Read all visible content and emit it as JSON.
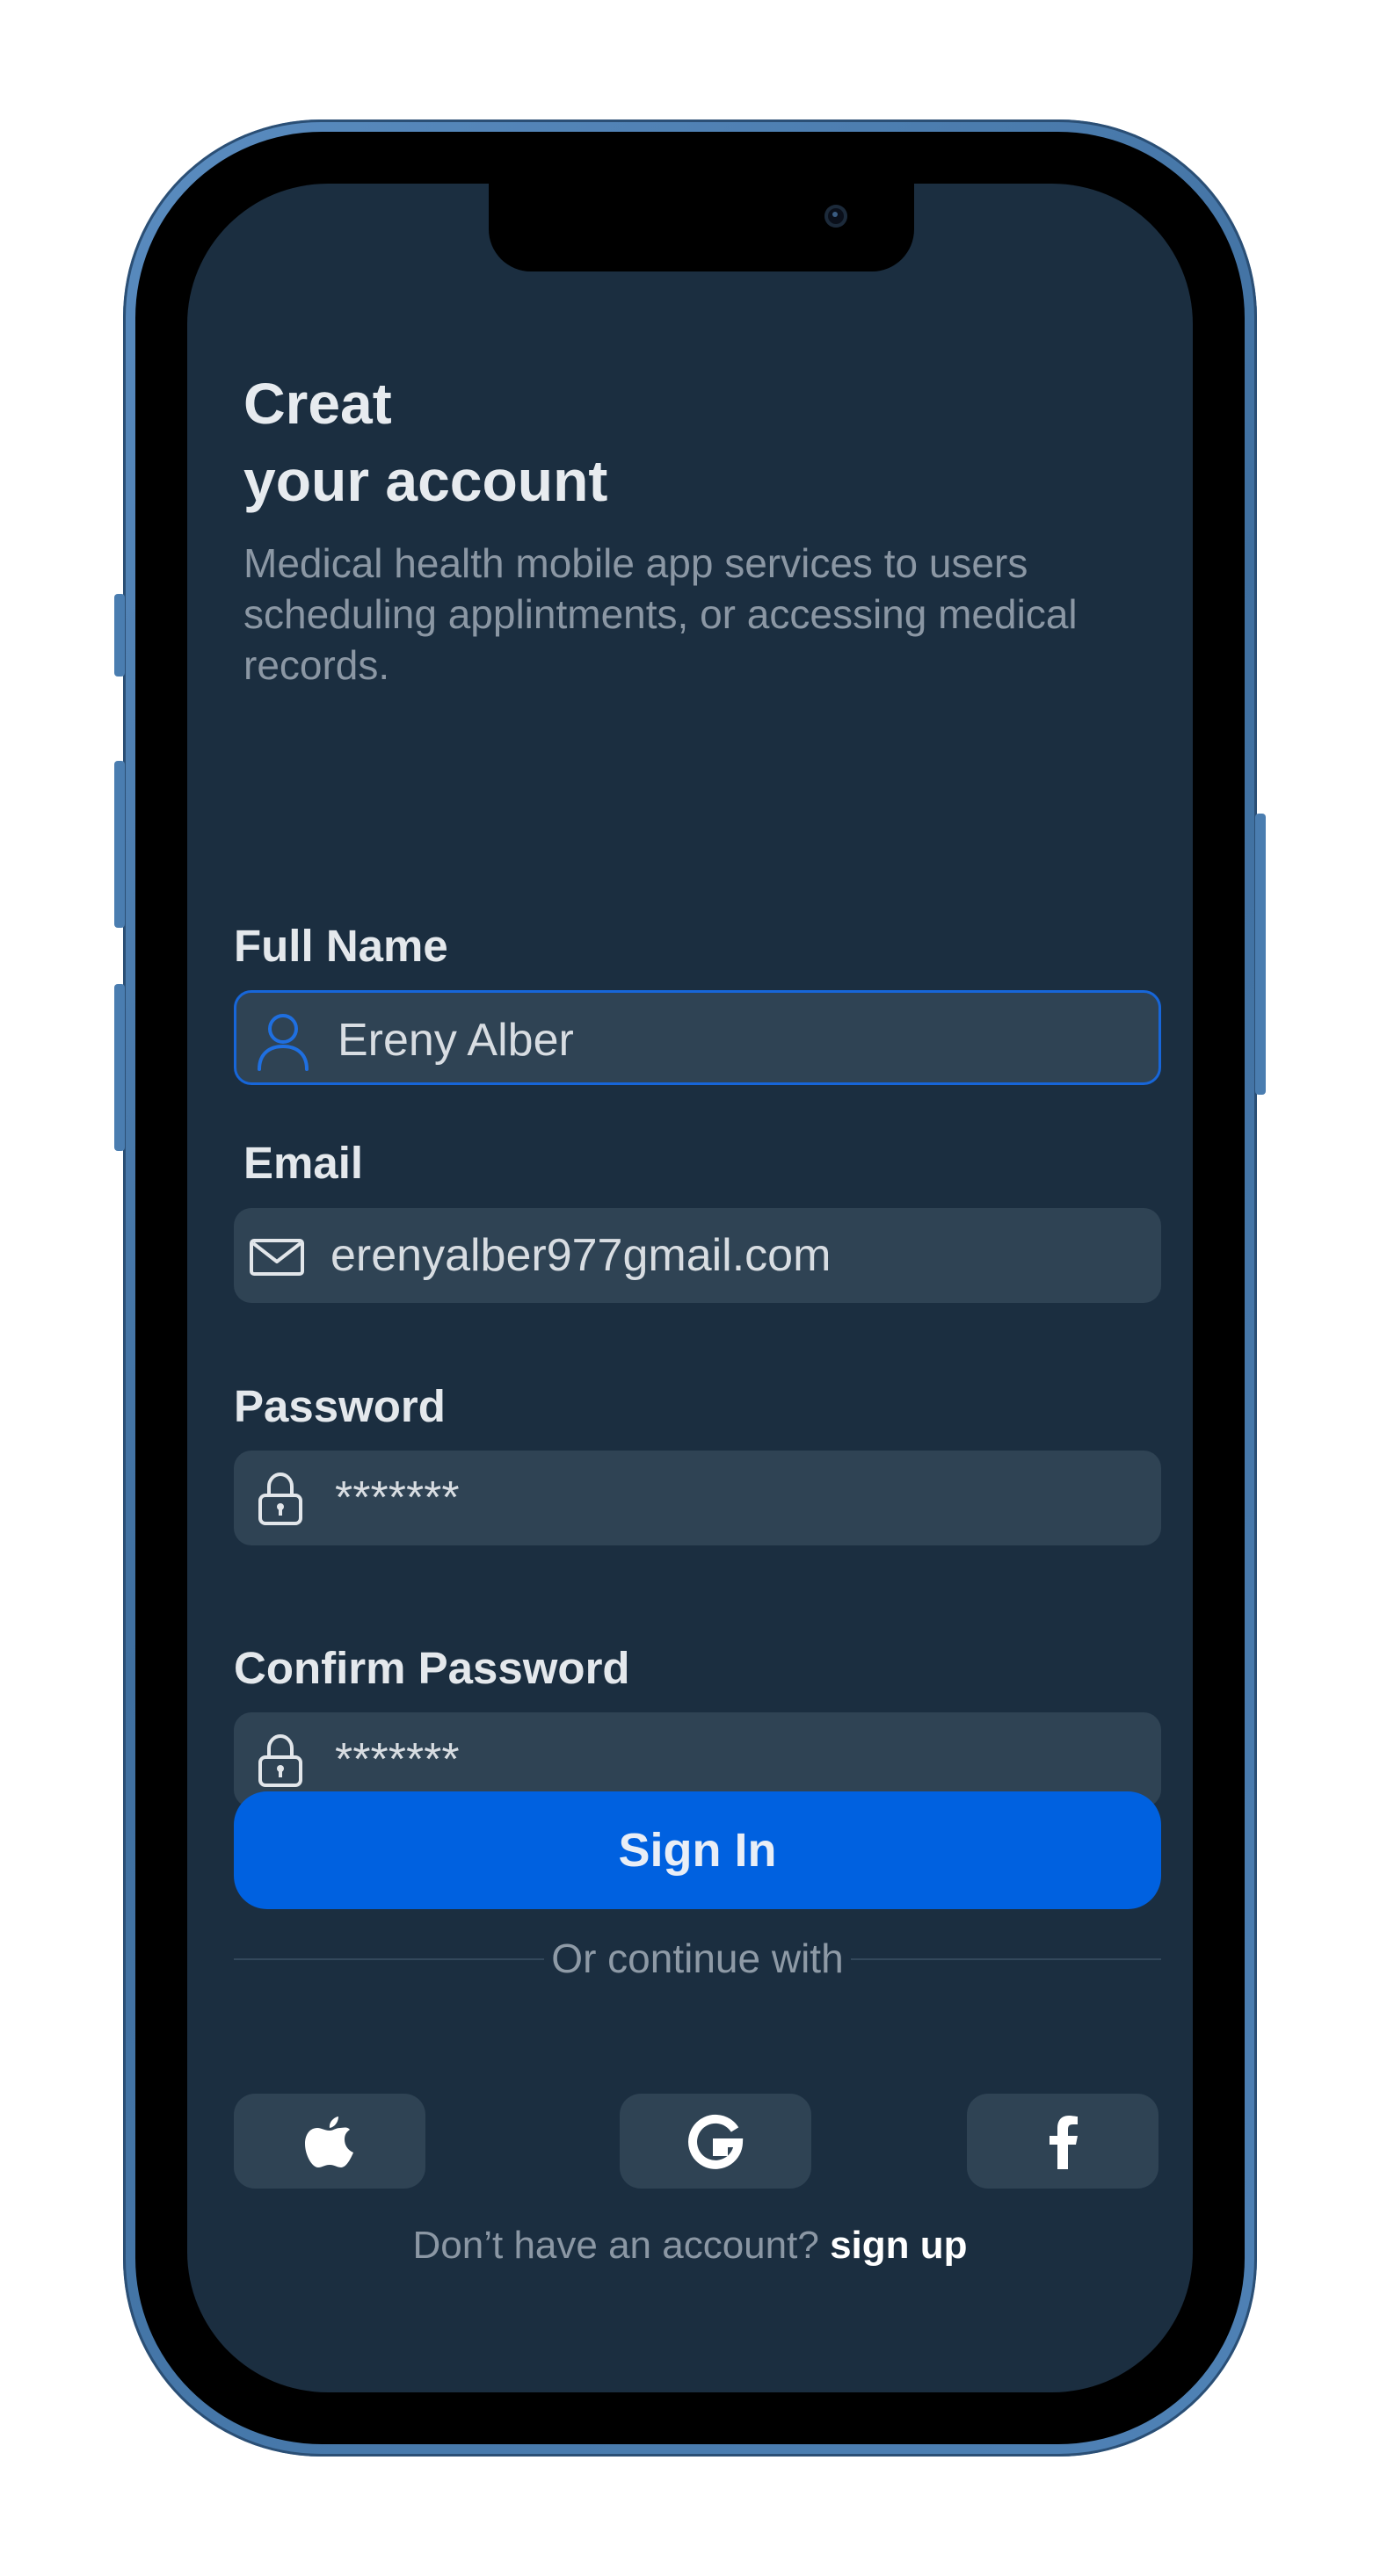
{
  "header": {
    "title_line1": "Creat",
    "title_line2": "your account",
    "subtitle": "Medical health mobile app services to users scheduling applintments, or accessing medical records."
  },
  "form": {
    "full_name": {
      "label": "Full Name",
      "value": "Ereny Alber",
      "icon": "user-icon"
    },
    "email": {
      "label": "Email",
      "value": "erenyalber977gmail.com",
      "icon": "mail-icon"
    },
    "password": {
      "label": "Password",
      "value": "*******",
      "icon": "lock-icon"
    },
    "confirm_password": {
      "label": "Confirm Password",
      "value": "*******",
      "icon": "lock-icon"
    }
  },
  "actions": {
    "primary_label": "Sign In",
    "divider_text": "Or continue with"
  },
  "social": [
    {
      "icon": "apple-icon"
    },
    {
      "icon": "google-icon"
    },
    {
      "icon": "facebook-icon"
    }
  ],
  "footer": {
    "prompt": "Don’t have an account?",
    "link": "sign up"
  },
  "colors": {
    "background": "#1b2e40",
    "field": "#2f4354",
    "accent": "#0061e0",
    "frame": "#4f82b6"
  }
}
